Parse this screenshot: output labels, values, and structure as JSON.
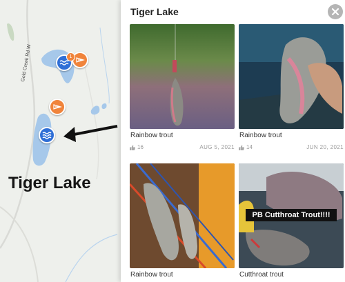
{
  "map": {
    "lake_label": "Tiger Lake",
    "road_label": "Gold Creek Rd W",
    "cluster_count": "1"
  },
  "panel": {
    "title": "Tiger Lake",
    "cards": [
      {
        "species": "Rainbow trout",
        "likes": "16",
        "date": "AUG 5, 2021"
      },
      {
        "species": "Rainbow trout",
        "likes": "14",
        "date": "JUN 20, 2021"
      },
      {
        "species": "Rainbow trout",
        "likes": "",
        "date": ""
      },
      {
        "species": "Cutthroat trout",
        "likes": "",
        "date": "",
        "photo_caption": "PB Cutthroat Trout!!!!"
      }
    ]
  },
  "colors": {
    "water": "#a6c8ea",
    "land": "#eef0ec",
    "pin_blue": "#2f6fd6",
    "pin_orange": "#f0843b",
    "close_button": "#b5b5b5"
  },
  "icons": [
    "water-icon",
    "fish-icon",
    "close-icon",
    "thumbs-up-icon",
    "arrow-icon"
  ]
}
